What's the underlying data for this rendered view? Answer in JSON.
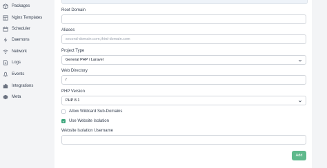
{
  "sidebar": {
    "items": [
      {
        "label": "Packages",
        "icon": "package-icon"
      },
      {
        "label": "Nginx Templates",
        "icon": "template-icon"
      },
      {
        "label": "Scheduler",
        "icon": "calendar-icon"
      },
      {
        "label": "Daemons",
        "icon": "bolt-icon"
      },
      {
        "label": "Network",
        "icon": "wifi-icon"
      },
      {
        "label": "Logs",
        "icon": "document-icon"
      },
      {
        "label": "Events",
        "icon": "bell-icon"
      },
      {
        "label": "Integrations",
        "icon": "puzzle-icon"
      },
      {
        "label": "Meta",
        "icon": "cube-icon"
      }
    ]
  },
  "form": {
    "root_domain": {
      "label": "Root Domain",
      "value": ""
    },
    "aliases": {
      "label": "Aliases",
      "placeholder": "second-domain.com,third-domain.com",
      "value": ""
    },
    "project_type": {
      "label": "Project Type",
      "value": "General PHP / Laravel"
    },
    "web_directory": {
      "label": "Web Directory",
      "value": "/"
    },
    "php_version": {
      "label": "PHP Version",
      "value": "PHP 8.1"
    },
    "wildcard": {
      "label": "Allow Wildcard Sub-Domains",
      "checked": false
    },
    "isolation": {
      "label": "Use Website Isolation",
      "checked": true
    },
    "isolation_username": {
      "label": "Website Isolation Username",
      "value": ""
    },
    "add_label": "Add"
  },
  "colors": {
    "accent": "#5fb98c",
    "checkbox_on": "#3aa57a"
  }
}
